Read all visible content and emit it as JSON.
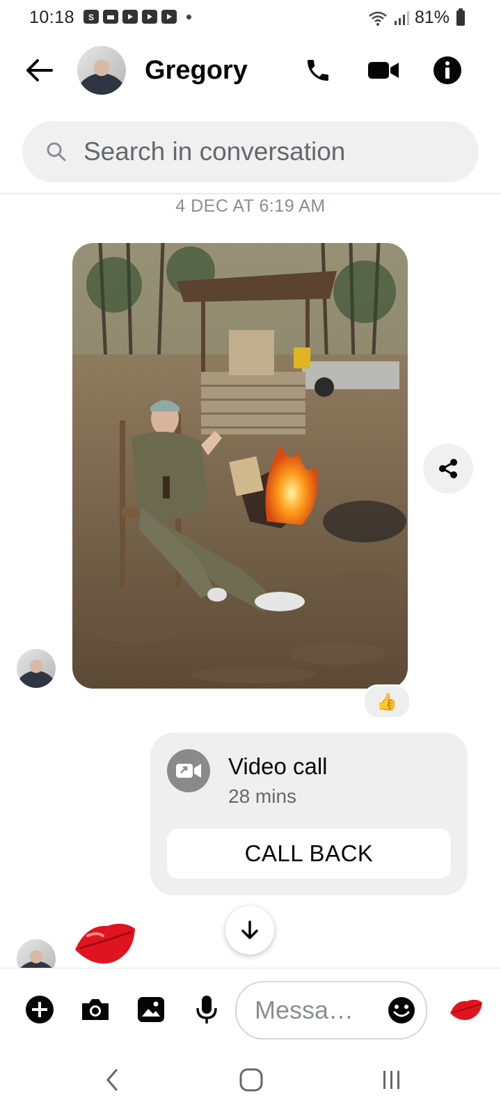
{
  "status_bar": {
    "time": "10:18",
    "battery": "81%",
    "notification_icons": [
      "shopping-bag-icon",
      "folder-icon",
      "youtube-icon",
      "youtube-icon",
      "youtube-icon",
      "more-dot-icon"
    ]
  },
  "header": {
    "contact_name": "Gregory",
    "actions": [
      "phone-icon",
      "video-camera-icon",
      "info-icon"
    ]
  },
  "search": {
    "placeholder": "Search in conversation"
  },
  "conversation": {
    "timestamp": "4 DEC AT 6:19 AM",
    "photo_message": {
      "reaction": "👍"
    },
    "call_card": {
      "title": "Video call",
      "duration": "28 mins",
      "action_label": "CALL BACK"
    },
    "last_message_icon": "lips-kiss-icon"
  },
  "composer": {
    "placeholder": "Messa…",
    "buttons": [
      "plus-icon",
      "camera-icon",
      "image-icon",
      "microphone-icon",
      "emoji-icon",
      "lips-kiss-icon"
    ]
  },
  "colors": {
    "accent": "#000000",
    "bubble_gray": "#efefef",
    "kiss_red": "#e0141e"
  }
}
